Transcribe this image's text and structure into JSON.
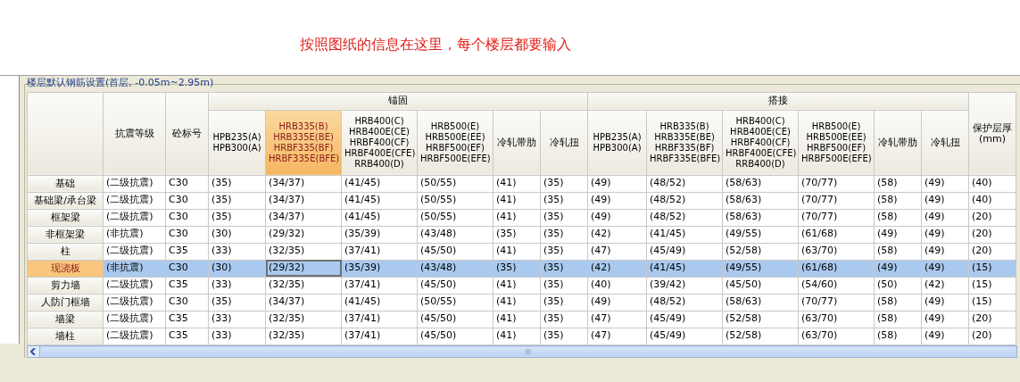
{
  "instruction": "按照图纸的信息在这里，每个楼层都要输入",
  "group_title": "楼层默认钢筋设置(首层, -0.05m~2.95m)",
  "columns": [
    {
      "kind": "single",
      "lines": [
        "抗震等级"
      ],
      "selected": false
    },
    {
      "kind": "single",
      "lines": [
        "砼标号"
      ],
      "selected": false
    },
    {
      "kind": "group",
      "label": "锚固",
      "children": [
        {
          "lines": [
            "HPB235(A)",
            "HPB300(A)"
          ],
          "selected": false
        },
        {
          "lines": [
            "HRB335(B)",
            "HRB335E(BE)",
            "HRBF335(BF)",
            "HRBF335E(BFE)"
          ],
          "selected": true
        },
        {
          "lines": [
            "HRB400(C)",
            "HRB400E(CE)",
            "HRBF400(CF)",
            "HRBF400E(CFE)",
            "RRB400(D)"
          ],
          "selected": false
        },
        {
          "lines": [
            "HRB500(E)",
            "HRB500E(EE)",
            "HRBF500(EF)",
            "HRBF500E(EFE)"
          ],
          "selected": false
        },
        {
          "lines": [
            "冷轧带肋"
          ],
          "selected": false
        },
        {
          "lines": [
            "冷轧扭"
          ],
          "selected": false
        }
      ]
    },
    {
      "kind": "group",
      "label": "搭接",
      "children": [
        {
          "lines": [
            "HPB235(A)",
            "HPB300(A)"
          ],
          "selected": false
        },
        {
          "lines": [
            "HRB335(B)",
            "HRB335E(BE)",
            "HRBF335(BF)",
            "HRBF335E(BFE)"
          ],
          "selected": false
        },
        {
          "lines": [
            "HRB400(C)",
            "HRB400E(CE)",
            "HRBF400(CF)",
            "HRBF400E(CFE)",
            "RRB400(D)"
          ],
          "selected": false
        },
        {
          "lines": [
            "HRB500(E)",
            "HRB500E(EE)",
            "HRBF500(EF)",
            "HRBF500E(EFE)"
          ],
          "selected": false
        },
        {
          "lines": [
            "冷轧带肋"
          ],
          "selected": false
        },
        {
          "lines": [
            "冷轧扭"
          ],
          "selected": false
        }
      ]
    },
    {
      "kind": "single",
      "lines": [
        "保护层厚",
        "(mm)"
      ],
      "selected": false
    }
  ],
  "rows": [
    {
      "header": "基础",
      "selected": false,
      "cells": [
        "(二级抗震)",
        "C30",
        "(35)",
        "(34/37)",
        "(41/45)",
        "(50/55)",
        "(41)",
        "(35)",
        "(49)",
        "(48/52)",
        "(58/63)",
        "(70/77)",
        "(58)",
        "(49)",
        "(40)"
      ]
    },
    {
      "header": "基础梁/承台梁",
      "selected": false,
      "cells": [
        "(二级抗震)",
        "C30",
        "(35)",
        "(34/37)",
        "(41/45)",
        "(50/55)",
        "(41)",
        "(35)",
        "(49)",
        "(48/52)",
        "(58/63)",
        "(70/77)",
        "(58)",
        "(49)",
        "(40)"
      ]
    },
    {
      "header": "框架梁",
      "selected": false,
      "cells": [
        "(二级抗震)",
        "C30",
        "(35)",
        "(34/37)",
        "(41/45)",
        "(50/55)",
        "(41)",
        "(35)",
        "(49)",
        "(48/52)",
        "(58/63)",
        "(70/77)",
        "(58)",
        "(49)",
        "(20)"
      ]
    },
    {
      "header": "非框架梁",
      "selected": false,
      "cells": [
        "(非抗震)",
        "C30",
        "(30)",
        "(29/32)",
        "(35/39)",
        "(43/48)",
        "(35)",
        "(35)",
        "(42)",
        "(41/45)",
        "(49/55)",
        "(61/68)",
        "(49)",
        "(49)",
        "(20)"
      ]
    },
    {
      "header": "柱",
      "selected": false,
      "cells": [
        "(二级抗震)",
        "C35",
        "(33)",
        "(32/35)",
        "(37/41)",
        "(45/50)",
        "(41)",
        "(35)",
        "(47)",
        "(45/49)",
        "(52/58)",
        "(63/70)",
        "(58)",
        "(49)",
        "(20)"
      ]
    },
    {
      "header": "现浇板",
      "selected": true,
      "cells": [
        "(非抗震)",
        "C30",
        "(30)",
        "(29/32)",
        "(35/39)",
        "(43/48)",
        "(35)",
        "(35)",
        "(42)",
        "(41/45)",
        "(49/55)",
        "(61/68)",
        "(49)",
        "(49)",
        "(15)"
      ]
    },
    {
      "header": "剪力墙",
      "selected": false,
      "cells": [
        "(二级抗震)",
        "C35",
        "(33)",
        "(32/35)",
        "(37/41)",
        "(45/50)",
        "(41)",
        "(35)",
        "(40)",
        "(39/42)",
        "(45/50)",
        "(54/60)",
        "(50)",
        "(42)",
        "(15)"
      ]
    },
    {
      "header": "人防门框墙",
      "selected": false,
      "cells": [
        "(二级抗震)",
        "C30",
        "(35)",
        "(34/37)",
        "(41/45)",
        "(50/55)",
        "(41)",
        "(35)",
        "(49)",
        "(48/52)",
        "(58/63)",
        "(70/77)",
        "(58)",
        "(49)",
        "(15)"
      ]
    },
    {
      "header": "墙梁",
      "selected": false,
      "cells": [
        "(二级抗震)",
        "C35",
        "(33)",
        "(32/35)",
        "(37/41)",
        "(45/50)",
        "(41)",
        "(35)",
        "(47)",
        "(45/49)",
        "(52/58)",
        "(63/70)",
        "(58)",
        "(49)",
        "(20)"
      ]
    },
    {
      "header": "墙柱",
      "selected": false,
      "cells": [
        "(二级抗震)",
        "C35",
        "(33)",
        "(32/35)",
        "(37/41)",
        "(45/50)",
        "(41)",
        "(35)",
        "(47)",
        "(45/49)",
        "(52/58)",
        "(63/70)",
        "(58)",
        "(49)",
        "(20)"
      ]
    }
  ]
}
